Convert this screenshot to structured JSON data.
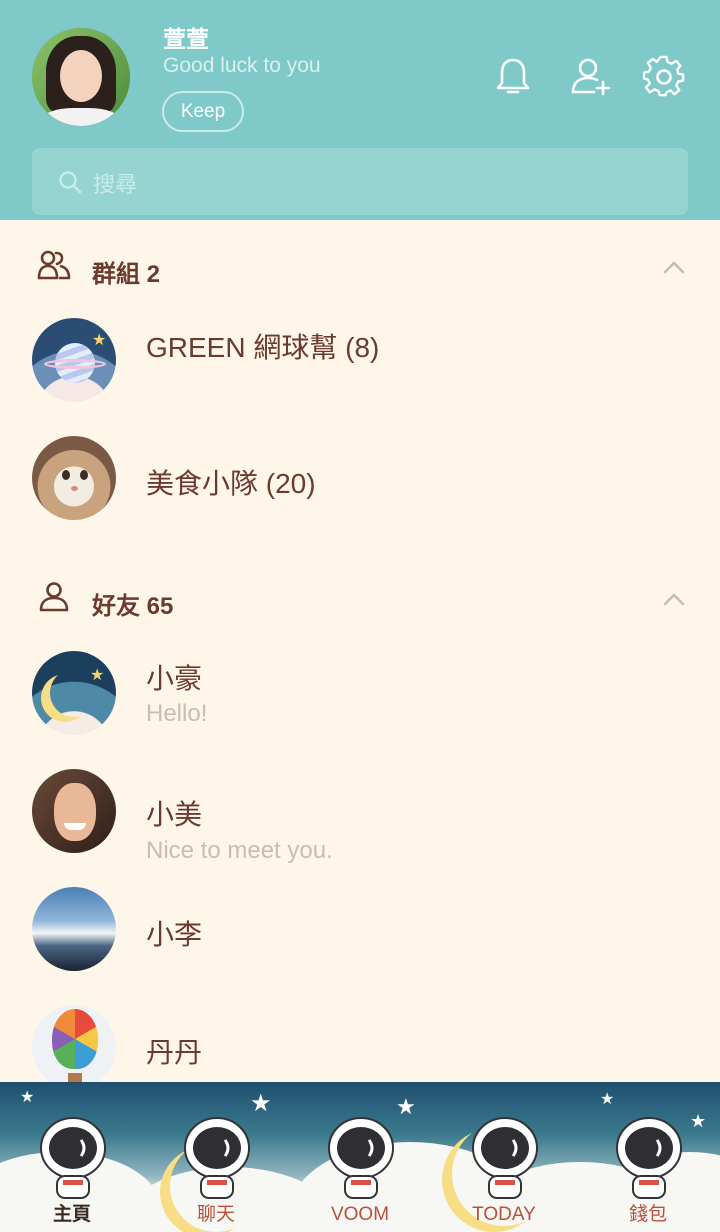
{
  "profile": {
    "name": "萱萱",
    "status": "Good luck to you",
    "keep_label": "Keep"
  },
  "search": {
    "placeholder": "搜尋"
  },
  "groups": {
    "title": "群組 2",
    "items": [
      {
        "name": "GREEN 網球幫 (8)"
      },
      {
        "name": "美食小隊 (20)"
      }
    ]
  },
  "friends": {
    "title": "好友 65",
    "items": [
      {
        "name": "小豪",
        "status": "Hello!"
      },
      {
        "name": "小美",
        "status": "Nice to meet you."
      },
      {
        "name": "小李"
      },
      {
        "name": "丹丹"
      }
    ]
  },
  "nav": {
    "items": [
      {
        "label": "主頁",
        "active": true
      },
      {
        "label": "聊天"
      },
      {
        "label": "VOOM"
      },
      {
        "label": "TODAY"
      },
      {
        "label": "錢包"
      }
    ]
  },
  "colors": {
    "header": "#7fc9c8",
    "background": "#fdf6e9",
    "title_text": "#6b3a2f",
    "sub_text": "#c9bcb0",
    "nav_label": "#b7513f"
  },
  "icons": [
    "bell-icon",
    "add-friend-icon",
    "gear-icon",
    "search-icon",
    "group-icon",
    "friend-icon",
    "chevron-up-icon"
  ]
}
